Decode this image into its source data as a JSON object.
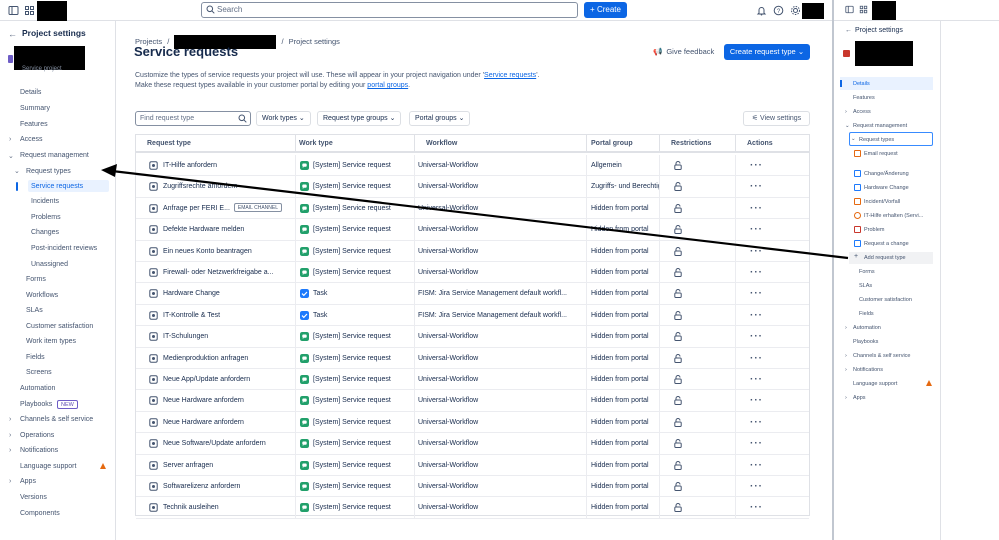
{
  "topbar": {
    "search_placeholder": "Search",
    "create_label": "+ Create"
  },
  "sidebar": {
    "title": "Project settings",
    "project_type": "Service project",
    "items": {
      "details": "Details",
      "summary": "Summary",
      "features": "Features",
      "access": "Access",
      "request_management": "Request management",
      "request_types": "Request types",
      "service_requests": "Service requests",
      "incidents": "Incidents",
      "problems": "Problems",
      "changes": "Changes",
      "post_incident": "Post-incident reviews",
      "unassigned": "Unassigned",
      "forms": "Forms",
      "workflows": "Workflows",
      "slas": "SLAs",
      "customer_satisfaction": "Customer satisfaction",
      "work_item_types": "Work item types",
      "fields": "Fields",
      "screens": "Screens",
      "automation": "Automation",
      "playbooks": "Playbooks",
      "new_badge": "NEW",
      "channels": "Channels & self service",
      "operations": "Operations",
      "notifications": "Notifications",
      "language_support": "Language support",
      "apps": "Apps",
      "versions": "Versions",
      "components": "Components"
    }
  },
  "breadcrumb": {
    "projects": "Projects",
    "sep": "/",
    "settings": "Project settings"
  },
  "page": {
    "title": "Service requests",
    "desc1_pre": "Customize the types of service requests your project will use. These will appear in your project navigation under '",
    "desc1_link": "Service requests",
    "desc1_post": "'.",
    "desc2_pre": "Make these request types available in your customer portal by editing your ",
    "desc2_link": "portal groups",
    "desc2_post": ".",
    "feedback": "Give feedback",
    "create_type": "Create request type"
  },
  "filters": {
    "search_placeholder": "Find request type",
    "work_types": "Work types",
    "request_type_groups": "Request type groups",
    "portal_groups": "Portal groups",
    "view_settings": "View settings"
  },
  "table": {
    "headers": {
      "request_type": "Request type",
      "work_type": "Work type",
      "workflow": "Workflow",
      "portal_group": "Portal group",
      "restrictions": "Restrictions",
      "actions": "Actions"
    },
    "email_badge": "EMAIL CHANNEL",
    "rows": [
      {
        "name": "IT-Hilfe anfordern",
        "work_type": "[System] Service request",
        "workflow": "Universal-Workflow",
        "portal": "Allgemein",
        "icon": "headset-icon",
        "color": "#22a06b",
        "wt": "service"
      },
      {
        "name": "Zugriffsrechte anfordern",
        "work_type": "[System] Service request",
        "workflow": "Universal-Workflow",
        "portal": "Zugriffs- und Berechtigungen",
        "icon": "key-icon",
        "color": "#22a06b",
        "wt": "service"
      },
      {
        "name": "Anfrage per FERI E...",
        "work_type": "[System] Service request",
        "workflow": "Universal-Workflow",
        "portal": "Hidden from portal",
        "icon": "mail-icon",
        "color": "#22a06b",
        "wt": "service",
        "email": true
      },
      {
        "name": "Defekte Hardware melden",
        "work_type": "[System] Service request",
        "workflow": "Universal-Workflow",
        "portal": "Hidden from portal",
        "icon": "laptop-icon",
        "color": "#22a06b",
        "wt": "service"
      },
      {
        "name": "Ein neues Konto beantragen",
        "work_type": "[System] Service request",
        "workflow": "Universal-Workflow",
        "portal": "Hidden from portal",
        "icon": "user-add-icon",
        "color": "#22a06b",
        "wt": "service"
      },
      {
        "name": "Firewall- oder Netzwerkfreigabe a...",
        "work_type": "[System] Service request",
        "workflow": "Universal-Workflow",
        "portal": "Hidden from portal",
        "icon": "network-icon",
        "color": "#22a06b",
        "wt": "service"
      },
      {
        "name": "Hardware Change",
        "work_type": "Task",
        "workflow": "FISM: Jira Service Management default workfl...",
        "portal": "Hidden from portal",
        "icon": "swap-icon",
        "color": "#1d7afc",
        "wt": "task"
      },
      {
        "name": "IT-Kontrolle & Test",
        "work_type": "Task",
        "workflow": "FISM: Jira Service Management default workfl...",
        "portal": "Hidden from portal",
        "icon": "checklist-icon",
        "color": "#1d7afc",
        "wt": "task"
      },
      {
        "name": "IT-Schulungen",
        "work_type": "[System] Service request",
        "workflow": "Universal-Workflow",
        "portal": "Hidden from portal",
        "icon": "people-icon",
        "color": "#22a06b",
        "wt": "service"
      },
      {
        "name": "Medienproduktion anfragen",
        "work_type": "[System] Service request",
        "workflow": "Universal-Workflow",
        "portal": "Hidden from portal",
        "icon": "camera-icon",
        "color": "#22a06b",
        "wt": "service"
      },
      {
        "name": "Neue App/Update anfordern",
        "work_type": "[System] Service request",
        "workflow": "Universal-Workflow",
        "portal": "Hidden from portal",
        "icon": "app-icon",
        "color": "#22a06b",
        "wt": "service"
      },
      {
        "name": "Neue Hardware anfordern",
        "work_type": "[System] Service request",
        "workflow": "Universal-Workflow",
        "portal": "Hidden from portal",
        "icon": "monitor-icon",
        "color": "#22a06b",
        "wt": "service"
      },
      {
        "name": "Neue Hardware anfordern",
        "work_type": "[System] Service request",
        "workflow": "Universal-Workflow",
        "portal": "Hidden from portal",
        "icon": "monitor-icon",
        "color": "#22a06b",
        "wt": "service"
      },
      {
        "name": "Neue Software/Update anfordern",
        "work_type": "[System] Service request",
        "workflow": "Universal-Workflow",
        "portal": "Hidden from portal",
        "icon": "download-icon",
        "color": "#22a06b",
        "wt": "service"
      },
      {
        "name": "Server anfragen",
        "work_type": "[System] Service request",
        "workflow": "Universal-Workflow",
        "portal": "Hidden from portal",
        "icon": "server-icon",
        "color": "#22a06b",
        "wt": "service"
      },
      {
        "name": "Softwarelizenz anfordern",
        "work_type": "[System] Service request",
        "workflow": "Universal-Workflow",
        "portal": "Hidden from portal",
        "icon": "certificate-icon",
        "color": "#22a06b",
        "wt": "service"
      },
      {
        "name": "Technik ausleihen",
        "work_type": "[System] Service request",
        "workflow": "Universal-Workflow",
        "portal": "Hidden from portal",
        "icon": "user-device-icon",
        "color": "#22a06b",
        "wt": "service"
      }
    ]
  },
  "right_panel": {
    "title": "Project settings",
    "items": {
      "details": "Details",
      "features": "Features",
      "access": "Access",
      "request_management": "Request management",
      "request_types": "Request types",
      "email_request": "Email request",
      "change": "Change/Änderung",
      "hardware_change": "Hardware Change",
      "incident": "Incident/Vorfall",
      "it_help": "IT-Hilfe erhalten (Servi...",
      "problem": "Problem",
      "request_change": "Request a change",
      "add_request_type": "Add request type",
      "forms": "Forms",
      "slas": "SLAs",
      "customer_satisfaction": "Customer satisfaction",
      "fields": "Fields",
      "automation": "Automation",
      "playbooks": "Playbooks",
      "channels": "Channels & self service",
      "notifications": "Notifications",
      "language_support": "Language support",
      "apps": "Apps"
    },
    "colors": {
      "email": "#e56910",
      "change": "#1d7afc",
      "hardware": "#1d7afc",
      "incident": "#e56910",
      "it_help": "#e56910",
      "problem": "#c9372c",
      "request_change": "#1d7afc"
    }
  }
}
